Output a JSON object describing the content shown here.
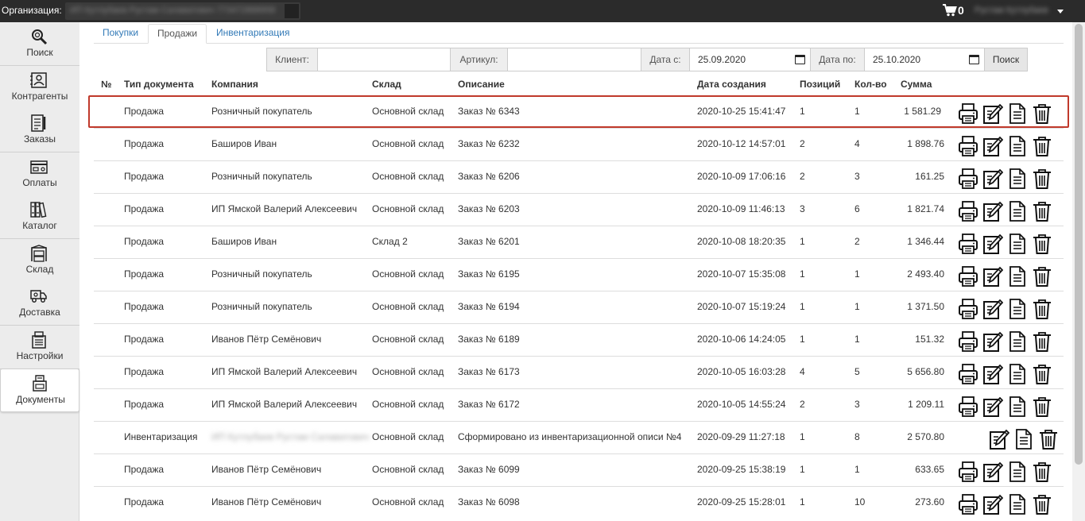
{
  "topbar": {
    "org_label": "Организация:",
    "org_value": "ИП Кутлубаев Рустам Салаватович 773472888958",
    "cart_count": "0",
    "user_name": "Рустам Кутлубаев"
  },
  "sidebar": {
    "items": [
      {
        "label": "Поиск",
        "icon": "search-icon"
      },
      {
        "label": "Контрагенты",
        "icon": "contacts-icon"
      },
      {
        "label": "Заказы",
        "icon": "orders-icon"
      },
      {
        "label": "Оплаты",
        "icon": "payments-icon"
      },
      {
        "label": "Каталог",
        "icon": "catalog-icon"
      },
      {
        "label": "Склад",
        "icon": "warehouse-icon"
      },
      {
        "label": "Доставка",
        "icon": "delivery-icon"
      },
      {
        "label": "Настройки",
        "icon": "settings-icon"
      },
      {
        "label": "Документы",
        "icon": "documents-icon"
      }
    ],
    "active_index": 8
  },
  "tabs": [
    {
      "label": "Покупки"
    },
    {
      "label": "Продажи"
    },
    {
      "label": "Инвентаризация"
    }
  ],
  "active_tab": 1,
  "filter": {
    "client_label": "Клиент:",
    "client_value": "",
    "article_label": "Артикул:",
    "article_value": "",
    "date_from_label": "Дата с:",
    "date_from_value": "25.09.2020",
    "date_to_label": "Дата по:",
    "date_to_value": "25.10.2020",
    "search_button": "Поиск"
  },
  "table": {
    "columns": [
      "№",
      "Тип документа",
      "Компания",
      "Склад",
      "Описание",
      "Дата создания",
      "Позиций",
      "Кол-во",
      "Сумма"
    ],
    "rows": [
      {
        "type": "Продажа",
        "company": "Розничный покупатель",
        "warehouse": "Основной склад",
        "description": "Заказ № 6343",
        "created": "2020-10-25 15:41:47",
        "positions": "1",
        "qty": "1",
        "sum": "1 581.29",
        "print": true
      },
      {
        "type": "Продажа",
        "company": "Баширов Иван",
        "warehouse": "Основной склад",
        "description": "Заказ № 6232",
        "created": "2020-10-12 14:57:01",
        "positions": "2",
        "qty": "4",
        "sum": "1 898.76",
        "print": true
      },
      {
        "type": "Продажа",
        "company": "Розничный покупатель",
        "warehouse": "Основной склад",
        "description": "Заказ № 6206",
        "created": "2020-10-09 17:06:16",
        "positions": "2",
        "qty": "3",
        "sum": "161.25",
        "print": true
      },
      {
        "type": "Продажа",
        "company": "ИП Ямской Валерий Алексеевич",
        "warehouse": "Основной склад",
        "description": "Заказ № 6203",
        "created": "2020-10-09 11:46:13",
        "positions": "3",
        "qty": "6",
        "sum": "1 821.74",
        "print": true
      },
      {
        "type": "Продажа",
        "company": "Баширов Иван",
        "warehouse": "Склад 2",
        "description": "Заказ № 6201",
        "created": "2020-10-08 18:20:35",
        "positions": "1",
        "qty": "2",
        "sum": "1 346.44",
        "print": true
      },
      {
        "type": "Продажа",
        "company": "Розничный покупатель",
        "warehouse": "Основной склад",
        "description": "Заказ № 6195",
        "created": "2020-10-07 15:35:08",
        "positions": "1",
        "qty": "1",
        "sum": "2 493.40",
        "print": true
      },
      {
        "type": "Продажа",
        "company": "Розничный покупатель",
        "warehouse": "Основной склад",
        "description": "Заказ № 6194",
        "created": "2020-10-07 15:19:24",
        "positions": "1",
        "qty": "1",
        "sum": "1 371.50",
        "print": true
      },
      {
        "type": "Продажа",
        "company": "Иванов Пётр Семёнович",
        "warehouse": "Основной склад",
        "description": "Заказ № 6189",
        "created": "2020-10-06 14:24:05",
        "positions": "1",
        "qty": "1",
        "sum": "151.32",
        "print": true
      },
      {
        "type": "Продажа",
        "company": "ИП Ямской Валерий Алексеевич",
        "warehouse": "Основной склад",
        "description": "Заказ № 6173",
        "created": "2020-10-05 16:03:28",
        "positions": "4",
        "qty": "5",
        "sum": "5 656.80",
        "print": true
      },
      {
        "type": "Продажа",
        "company": "ИП Ямской Валерий Алексеевич",
        "warehouse": "Основной склад",
        "description": "Заказ № 6172",
        "created": "2020-10-05 14:55:24",
        "positions": "2",
        "qty": "3",
        "sum": "1 209.11",
        "print": true
      },
      {
        "type": "Инвентаризация",
        "company": "ИП Кутлубаев Рустам Салаватович",
        "warehouse": "Основной склад",
        "description": "Сформировано из инвентаризационной описи №4",
        "created": "2020-09-29 11:27:18",
        "positions": "1",
        "qty": "8",
        "sum": "2 570.80",
        "print": false,
        "company_blurred": true
      },
      {
        "type": "Продажа",
        "company": "Иванов Пётр Семёнович",
        "warehouse": "Основной склад",
        "description": "Заказ № 6099",
        "created": "2020-09-25 15:38:19",
        "positions": "1",
        "qty": "1",
        "sum": "633.65",
        "print": true
      },
      {
        "type": "Продажа",
        "company": "Иванов Пётр Семёнович",
        "warehouse": "Основной склад",
        "description": "Заказ № 6098",
        "created": "2020-09-25 15:28:01",
        "positions": "1",
        "qty": "10",
        "sum": "273.60",
        "print": true
      }
    ],
    "highlighted_row": 0
  },
  "colors": {
    "topbar_bg": "#2b2b2b",
    "link_blue": "#337ab7",
    "highlight_red": "#c0392b"
  }
}
